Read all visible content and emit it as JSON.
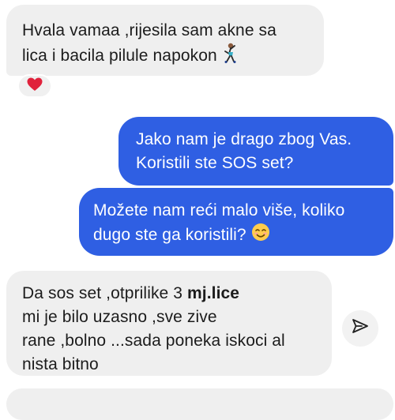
{
  "messages": [
    {
      "direction": "incoming",
      "lines": [
        "Hvala vamaa ,rijesila sam akne sa",
        "lica i bacila pilule napokon"
      ],
      "trailing_emoji": "dancing-person-icon",
      "reaction": "heart-icon"
    },
    {
      "direction": "outgoing",
      "lines": [
        "Jako nam je drago zbog Vas.",
        "Koristili ste SOS set?"
      ]
    },
    {
      "direction": "outgoing",
      "lines": [
        "Možete nam reći malo više, koliko",
        "dugo ste ga koristili?"
      ],
      "trailing_emoji": "smiling-face-icon"
    },
    {
      "direction": "incoming",
      "line1_start": "Da sos set ,otprilike 3 ",
      "line1_bold": "mj.lice",
      "lines_rest": [
        "mi je bilo uzasno ,sve zive",
        "rane ,bolno ...sada poneka iskoci al",
        "nista bitno"
      ]
    }
  ],
  "actions": {
    "share_icon": "send-arrow-icon"
  },
  "colors": {
    "incoming_bubble": "#efefef",
    "outgoing_bubble": "#2f5fe3",
    "heart": "#e0213b"
  }
}
